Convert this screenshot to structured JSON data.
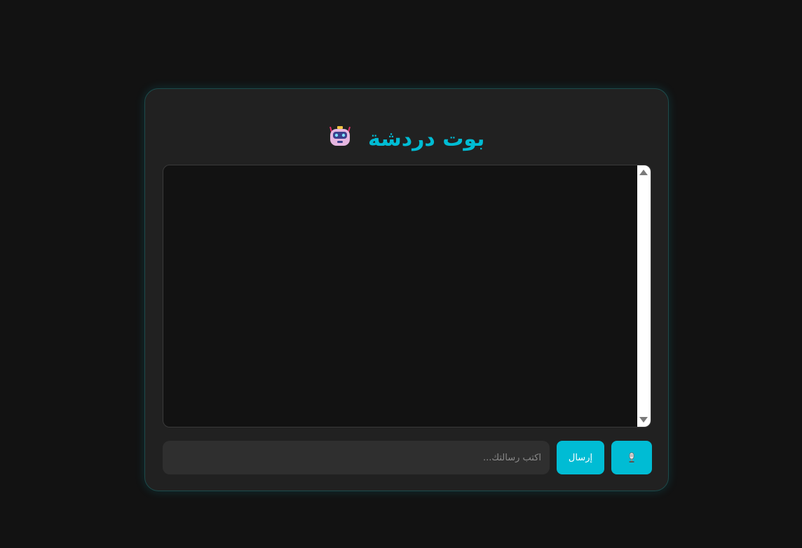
{
  "header": {
    "title": "بوت دردشة",
    "icon": "robot-icon"
  },
  "chat": {
    "messages": []
  },
  "composer": {
    "placeholder": "اكتب رسالتك...",
    "value": "",
    "send_label": "إرسال",
    "mic_icon": "microphone-icon"
  },
  "colors": {
    "accent": "#00bcd4",
    "background": "#121212",
    "card": "#212121",
    "input": "#2f2f2f"
  }
}
